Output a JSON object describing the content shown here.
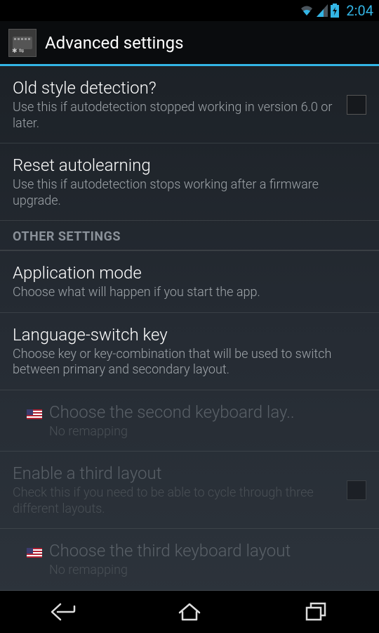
{
  "status_bar": {
    "time": "2:04"
  },
  "action_bar": {
    "title": "Advanced settings"
  },
  "items": {
    "old_style": {
      "title": "Old style detection?",
      "summary": "Use this if autodetection stopped working in version 6.0 or later."
    },
    "reset_autolearn": {
      "title": "Reset autolearning",
      "summary": "Use this if autodetection stops working after a firmware upgrade."
    },
    "other_settings_header": "OTHER SETTINGS",
    "app_mode": {
      "title": "Application mode",
      "summary": "Choose what will happen if you start the app."
    },
    "lang_switch": {
      "title": "Language-switch key",
      "summary": "Choose key or key-combination that will be used to switch between primary and secondary layout."
    },
    "second_layout": {
      "title": "Choose the second keyboard lay..",
      "summary": "No remapping"
    },
    "enable_third": {
      "title": "Enable a third layout",
      "summary": "Check this if you need to be able to cycle through three different layouts."
    },
    "third_layout": {
      "title": "Choose the third keyboard layout",
      "summary": "No remapping"
    }
  }
}
